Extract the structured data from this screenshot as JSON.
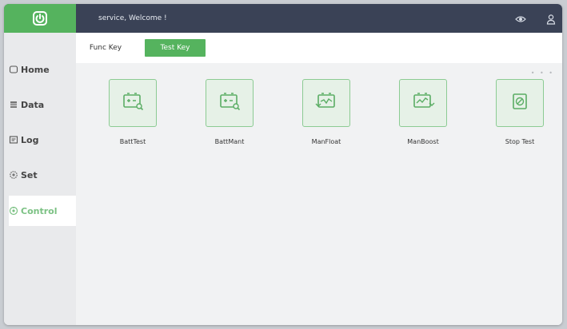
{
  "header": {
    "welcome": "service, Welcome !",
    "logo_icon": "power-icon",
    "right_icons": [
      "eye-icon",
      "user-icon"
    ]
  },
  "sidebar": {
    "items": [
      {
        "label": "Home",
        "icon": "home-icon"
      },
      {
        "label": "Data",
        "icon": "data-icon"
      },
      {
        "label": "Log",
        "icon": "log-icon"
      },
      {
        "label": "Set",
        "icon": "gear-icon"
      },
      {
        "label": "Control",
        "icon": "control-icon",
        "active": true
      }
    ]
  },
  "tabs": {
    "func_key": "Func Key",
    "test_key": "Test Key",
    "active": "Test Key"
  },
  "tiles": [
    {
      "label": "BattTest",
      "icon": "battery-search-icon"
    },
    {
      "label": "BattMant",
      "icon": "battery-search-icon"
    },
    {
      "label": "ManFloat",
      "icon": "battery-float-icon"
    },
    {
      "label": "ManBoost",
      "icon": "battery-boost-icon"
    },
    {
      "label": "Stop Test",
      "icon": "stop-icon"
    }
  ],
  "colors": {
    "brand_green": "#55b35e",
    "header_dark": "#3a4256",
    "active_text": "#7bc183",
    "tile_border": "#8ccb93"
  }
}
